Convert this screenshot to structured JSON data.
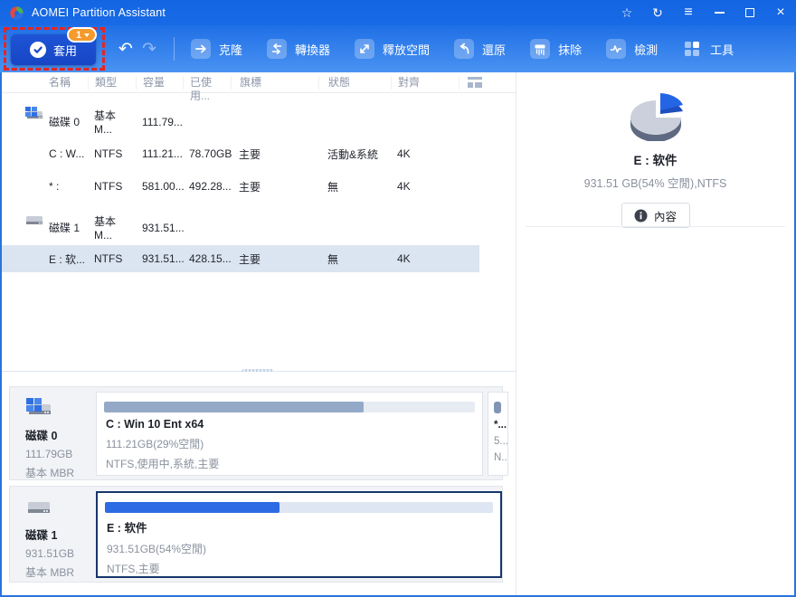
{
  "window": {
    "title": "AOMEI Partition Assistant",
    "controls": {
      "star": "☆",
      "refresh": "↻",
      "menu": "≡",
      "close": "×"
    }
  },
  "toolbar": {
    "apply_label": "套用",
    "apply_badge": "1",
    "undo": "↶",
    "redo": "↷",
    "buttons": [
      {
        "label": "克隆",
        "icon": "clone-icon"
      },
      {
        "label": "轉換器",
        "icon": "converter-icon"
      },
      {
        "label": "釋放空間",
        "icon": "free-space-icon"
      },
      {
        "label": "還原",
        "icon": "restore-icon"
      },
      {
        "label": "抹除",
        "icon": "wipe-icon"
      },
      {
        "label": "檢測",
        "icon": "test-icon"
      },
      {
        "label": "工具",
        "icon": "tools-icon"
      }
    ]
  },
  "table": {
    "columns": [
      "名稱",
      "類型",
      "容量",
      "已使用...",
      "旗標",
      "狀態",
      "對齊"
    ],
    "rows": [
      {
        "kind": "disk",
        "name": "磁碟 0",
        "type": "基本 M...",
        "capacity": "111.79...",
        "used": "",
        "flag": "",
        "status": "",
        "align": ""
      },
      {
        "kind": "partition",
        "name": "C : W...",
        "type": "NTFS",
        "capacity": "111.21...",
        "used": "78.70GB",
        "flag": "主要",
        "status": "活動&系統",
        "align": "4K"
      },
      {
        "kind": "partition",
        "name": "* :",
        "type": "NTFS",
        "capacity": "581.00...",
        "used": "492.28...",
        "flag": "主要",
        "status": "無",
        "align": "4K"
      },
      {
        "kind": "disk",
        "name": "磁碟 1",
        "type": "基本 M...",
        "capacity": "931.51...",
        "used": "",
        "flag": "",
        "status": "",
        "align": ""
      },
      {
        "kind": "partition",
        "name": "E : 软...",
        "type": "NTFS",
        "capacity": "931.51...",
        "used": "428.15...",
        "flag": "主要",
        "status": "無",
        "align": "4K",
        "selected": true
      }
    ]
  },
  "details": {
    "volume_title": "E : 软件",
    "volume_info": "931.51 GB(54% 空閒),NTFS",
    "contents_button": "內容"
  },
  "disks": [
    {
      "name": "磁碟 0",
      "size": "111.79GB",
      "layout": "基本 MBR",
      "partitions": [
        {
          "title": "C : Win 10 Ent x64",
          "info": "111.21GB(29%空閒)",
          "attrs": "NTFS,使用中,系統,主要",
          "used_pct": 70
        },
        {
          "title": "*...",
          "info": "5...",
          "attrs": "N..",
          "used_pct": 0
        }
      ]
    },
    {
      "name": "磁碟 1",
      "size": "931.51GB",
      "layout": "基本 MBR",
      "partitions": [
        {
          "title": "E : 软件",
          "info": "931.51GB(54%空閒)",
          "attrs": "NTFS,主要",
          "used_pct": 45,
          "selected": true
        }
      ]
    }
  ],
  "colors": {
    "titlebar": "#1566e2",
    "toolbar_top": "#1f6fe6",
    "toolbar_bottom": "#4a93f2",
    "apply_button": "#1747c6",
    "badge": "#f59a2b",
    "highlight_dashed": "#e8251f",
    "row_selected": "#dbe5f1",
    "bar_fill_gray": "#94a9c7",
    "bar_fill_blue": "#2c6be4",
    "pie_free": "#cbd0dc",
    "pie_used": "#2465e6"
  }
}
